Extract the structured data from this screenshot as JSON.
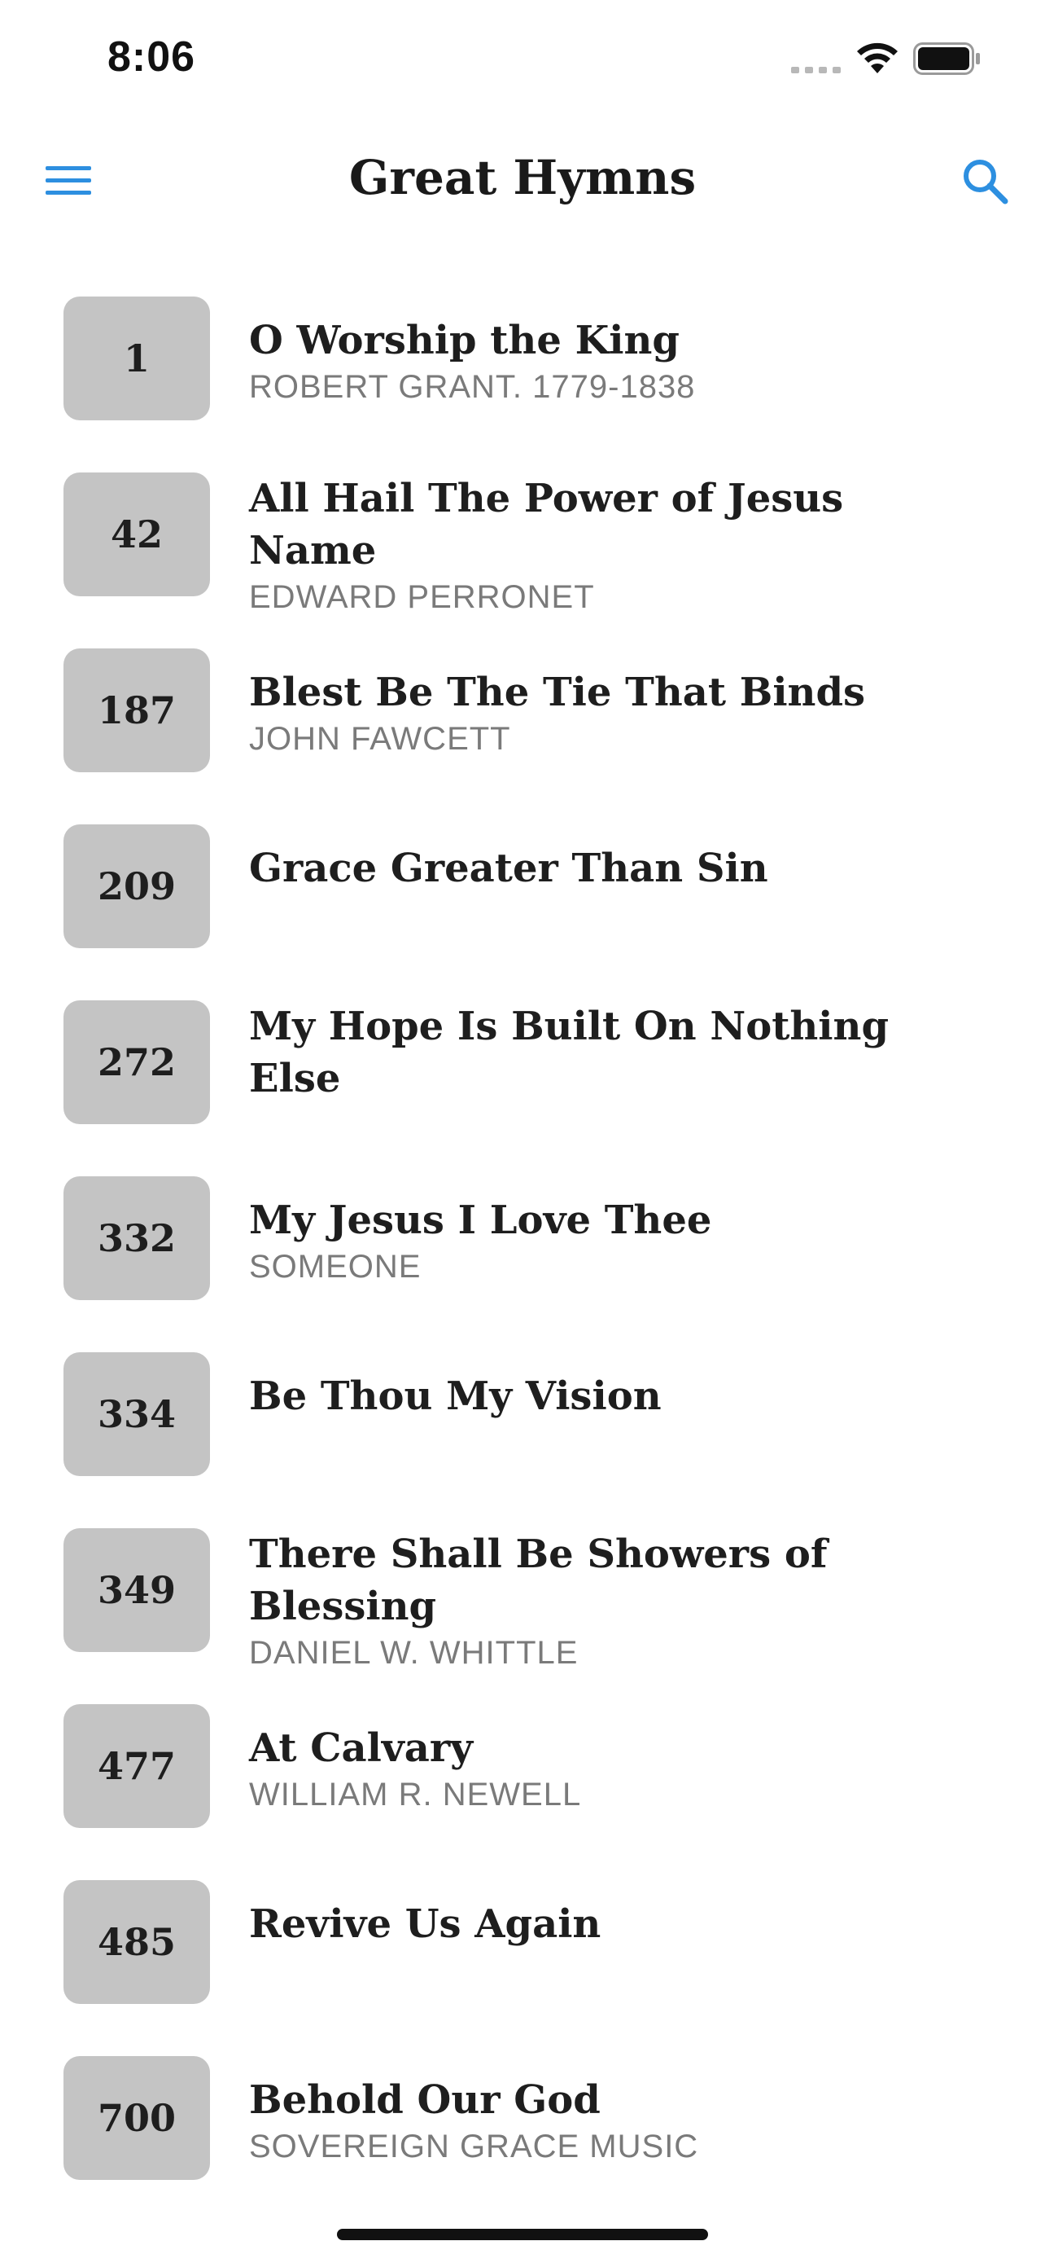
{
  "status_bar": {
    "time": "8:06"
  },
  "header": {
    "title": "Great Hymns",
    "menu_icon": "hamburger-menu-icon",
    "search_icon": "search-icon",
    "accent_color": "#2d8fe0"
  },
  "hymns": [
    {
      "number": "1",
      "title": "O Worship the King",
      "author": "ROBERT GRANT. 1779-1838"
    },
    {
      "number": "42",
      "title": "All Hail The Power of Jesus Name",
      "author": "EDWARD PERRONET"
    },
    {
      "number": "187",
      "title": "Blest Be The Tie That Binds",
      "author": "JOHN FAWCETT"
    },
    {
      "number": "209",
      "title": "Grace Greater Than Sin",
      "author": ""
    },
    {
      "number": "272",
      "title": "My Hope Is Built On Nothing Else",
      "author": ""
    },
    {
      "number": "332",
      "title": "My Jesus I Love Thee",
      "author": "SOMEONE"
    },
    {
      "number": "334",
      "title": "Be Thou My Vision",
      "author": ""
    },
    {
      "number": "349",
      "title": "There Shall Be Showers of Blessing",
      "author": "DANIEL W. WHITTLE"
    },
    {
      "number": "477",
      "title": "At Calvary",
      "author": "WILLIAM R. NEWELL"
    },
    {
      "number": "485",
      "title": "Revive Us Again",
      "author": ""
    },
    {
      "number": "700",
      "title": "Behold Our God",
      "author": "SOVEREIGN GRACE MUSIC"
    }
  ]
}
